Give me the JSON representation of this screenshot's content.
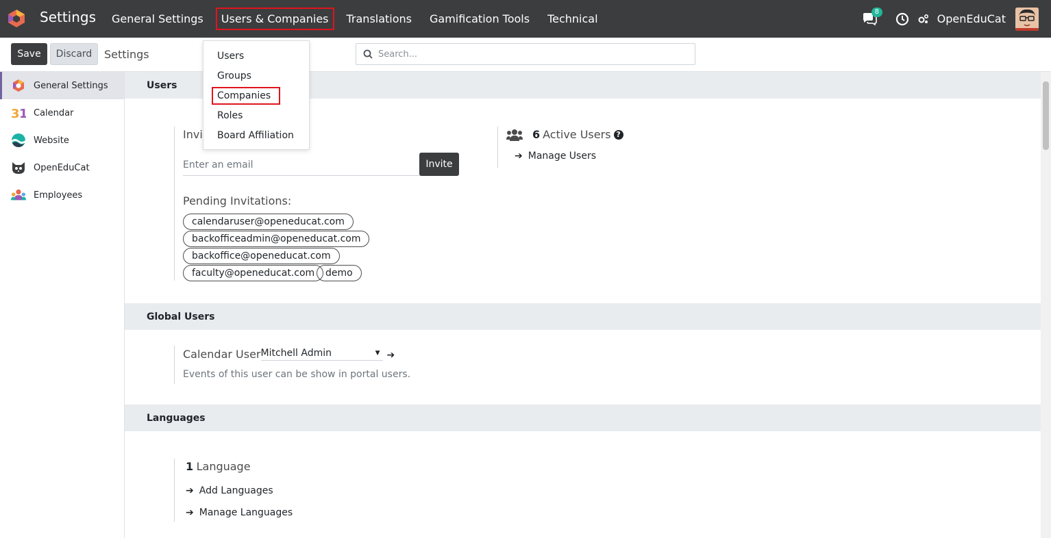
{
  "navbar": {
    "app_name": "Settings",
    "menu": [
      {
        "label": "General Settings"
      },
      {
        "label": "Users & Companies"
      },
      {
        "label": "Translations"
      },
      {
        "label": "Gamification Tools"
      },
      {
        "label": "Technical"
      }
    ],
    "chat_count": "8",
    "company": "OpenEduCat"
  },
  "dropdown": {
    "items": [
      {
        "label": "Users"
      },
      {
        "label": "Groups"
      },
      {
        "label": "Companies"
      },
      {
        "label": "Roles"
      },
      {
        "label": "Board Affiliation"
      }
    ]
  },
  "control": {
    "save_label": "Save",
    "discard_label": "Discard",
    "breadcrumb": "Settings",
    "search_placeholder": "Search..."
  },
  "sidebar": {
    "items": [
      {
        "label": "General Settings"
      },
      {
        "label": "Calendar"
      },
      {
        "label": "Website"
      },
      {
        "label": "OpenEduCat"
      },
      {
        "label": "Employees"
      }
    ]
  },
  "users_section": {
    "title": "Users",
    "invite_label": "Invit",
    "email_placeholder": "Enter an email",
    "invite_button": "Invite",
    "pending_title": "Pending Invitations:",
    "pending": [
      "calendaruser@openeducat.com",
      "backofficeadmin@openeducat.com",
      "backoffice@openeducat.com",
      "faculty@openeducat.com",
      "demo"
    ],
    "active_count": "6",
    "active_label": "Active Users",
    "manage_users": "Manage Users"
  },
  "global_users": {
    "title": "Global Users",
    "field_label": "Calendar User",
    "field_value": "Mitchell Admin",
    "description": "Events of this user can be show in portal users."
  },
  "languages": {
    "title": "Languages",
    "count": "1",
    "count_label": "Language",
    "add": "Add Languages",
    "manage": "Manage Languages"
  },
  "colors": {
    "navbar": "#3c3d3f",
    "accent": "#71639e",
    "highlight_border": "#e0141e",
    "badge": "#21b799"
  }
}
